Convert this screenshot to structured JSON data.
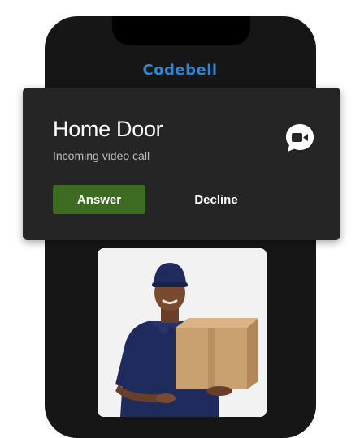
{
  "app": {
    "brand": "Codebell"
  },
  "call": {
    "title": "Home Door",
    "subtitle": "Incoming video call",
    "icon": "video-call-icon"
  },
  "actions": {
    "answer_label": "Answer",
    "decline_label": "Decline"
  },
  "video_feed": {
    "image": "delivery-person-holding-box"
  },
  "colors": {
    "brand": "#2f86d3",
    "card_bg": "#252525",
    "answer_bg": "#3d6b22",
    "phone_bg": "#161616"
  }
}
